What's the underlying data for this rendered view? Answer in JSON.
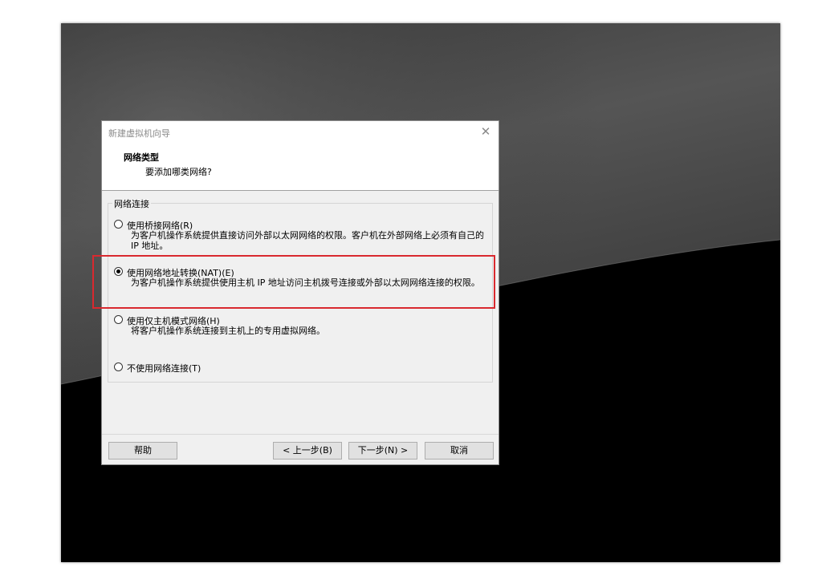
{
  "dialog": {
    "title": "新建虚拟机向导",
    "close_glyph": "✕",
    "header_title": "网络类型",
    "header_subtitle": "要添加哪类网络?",
    "group_label": "网络连接",
    "options": [
      {
        "label": "使用桥接网络(R)",
        "description": "为客户机操作系统提供直接访问外部以太网网络的权限。客户机在外部网络上必须有自己的 IP 地址。",
        "selected": false
      },
      {
        "label": "使用网络地址转换(NAT)(E)",
        "description": "为客户机操作系统提供使用主机 IP 地址访问主机拨号连接或外部以太网网络连接的权限。",
        "selected": true
      },
      {
        "label": "使用仅主机模式网络(H)",
        "description": "将客户机操作系统连接到主机上的专用虚拟网络。",
        "selected": false
      },
      {
        "label": "不使用网络连接(T)",
        "description": "",
        "selected": false
      }
    ],
    "buttons": {
      "help": "帮助",
      "back": "< 上一步(B)",
      "next": "下一步(N) >",
      "cancel": "取消"
    }
  },
  "colors": {
    "highlight": "#d9292f",
    "dialog_bg": "#f0f0f0"
  }
}
